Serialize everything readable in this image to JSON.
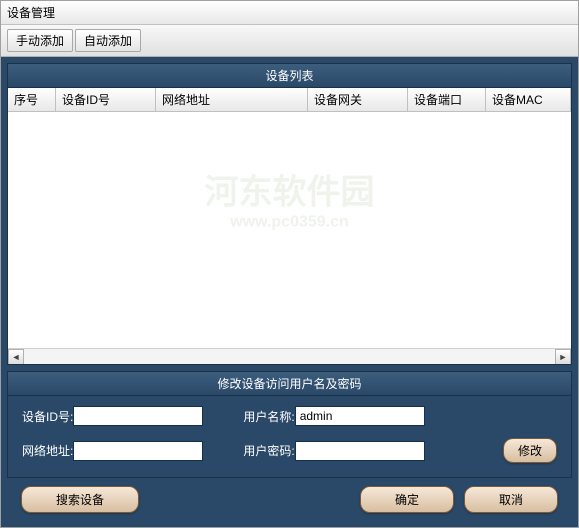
{
  "title": "设备管理",
  "toolbar": {
    "manual_add": "手动添加",
    "auto_add": "自动添加"
  },
  "list_panel": {
    "heading": "设备列表",
    "columns": [
      "序号",
      "设备ID号",
      "网络地址",
      "设备网关",
      "设备端口",
      "设备MAC"
    ],
    "rows": []
  },
  "edit_panel": {
    "heading": "修改设备访问用户名及密码",
    "device_id_label": "设备ID号:",
    "device_id_value": "",
    "username_label": "用户名称:",
    "username_value": "admin",
    "net_addr_label": "网络地址:",
    "net_addr_value": "",
    "password_label": "用户密码:",
    "password_value": "",
    "modify_btn": "修改"
  },
  "buttons": {
    "search": "搜索设备",
    "ok": "确定",
    "cancel": "取消"
  },
  "watermark": {
    "title": "河东软件园",
    "url": "www.pc0359.cn"
  }
}
